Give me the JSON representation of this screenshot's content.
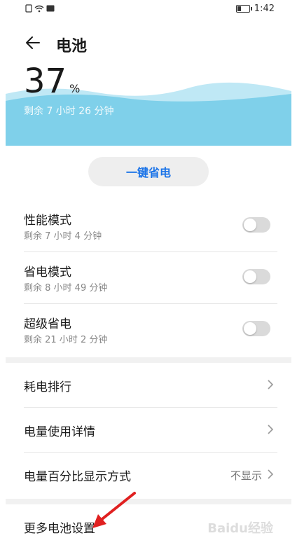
{
  "status_bar": {
    "time": "1:42"
  },
  "header": {
    "title": "电池"
  },
  "battery": {
    "percent": "37",
    "percent_unit": "%",
    "remaining": "剩余 7 小时 26 分钟"
  },
  "one_key_button": {
    "label": "一键省电"
  },
  "modes": [
    {
      "label": "性能模式",
      "sub": "剩余 7 小时 4 分钟"
    },
    {
      "label": "省电模式",
      "sub": "剩余 8 小时 49 分钟"
    },
    {
      "label": "超级省电",
      "sub": "剩余 21 小时 2 分钟"
    }
  ],
  "settings": [
    {
      "label": "耗电排行"
    },
    {
      "label": "电量使用详情"
    },
    {
      "label": "电量百分比显示方式",
      "value": "不显示"
    }
  ],
  "more": {
    "label": "更多电池设置"
  },
  "watermark": "Baidu经验",
  "colors": {
    "accent": "#1a73e8",
    "wave": "#7fd0ea"
  }
}
